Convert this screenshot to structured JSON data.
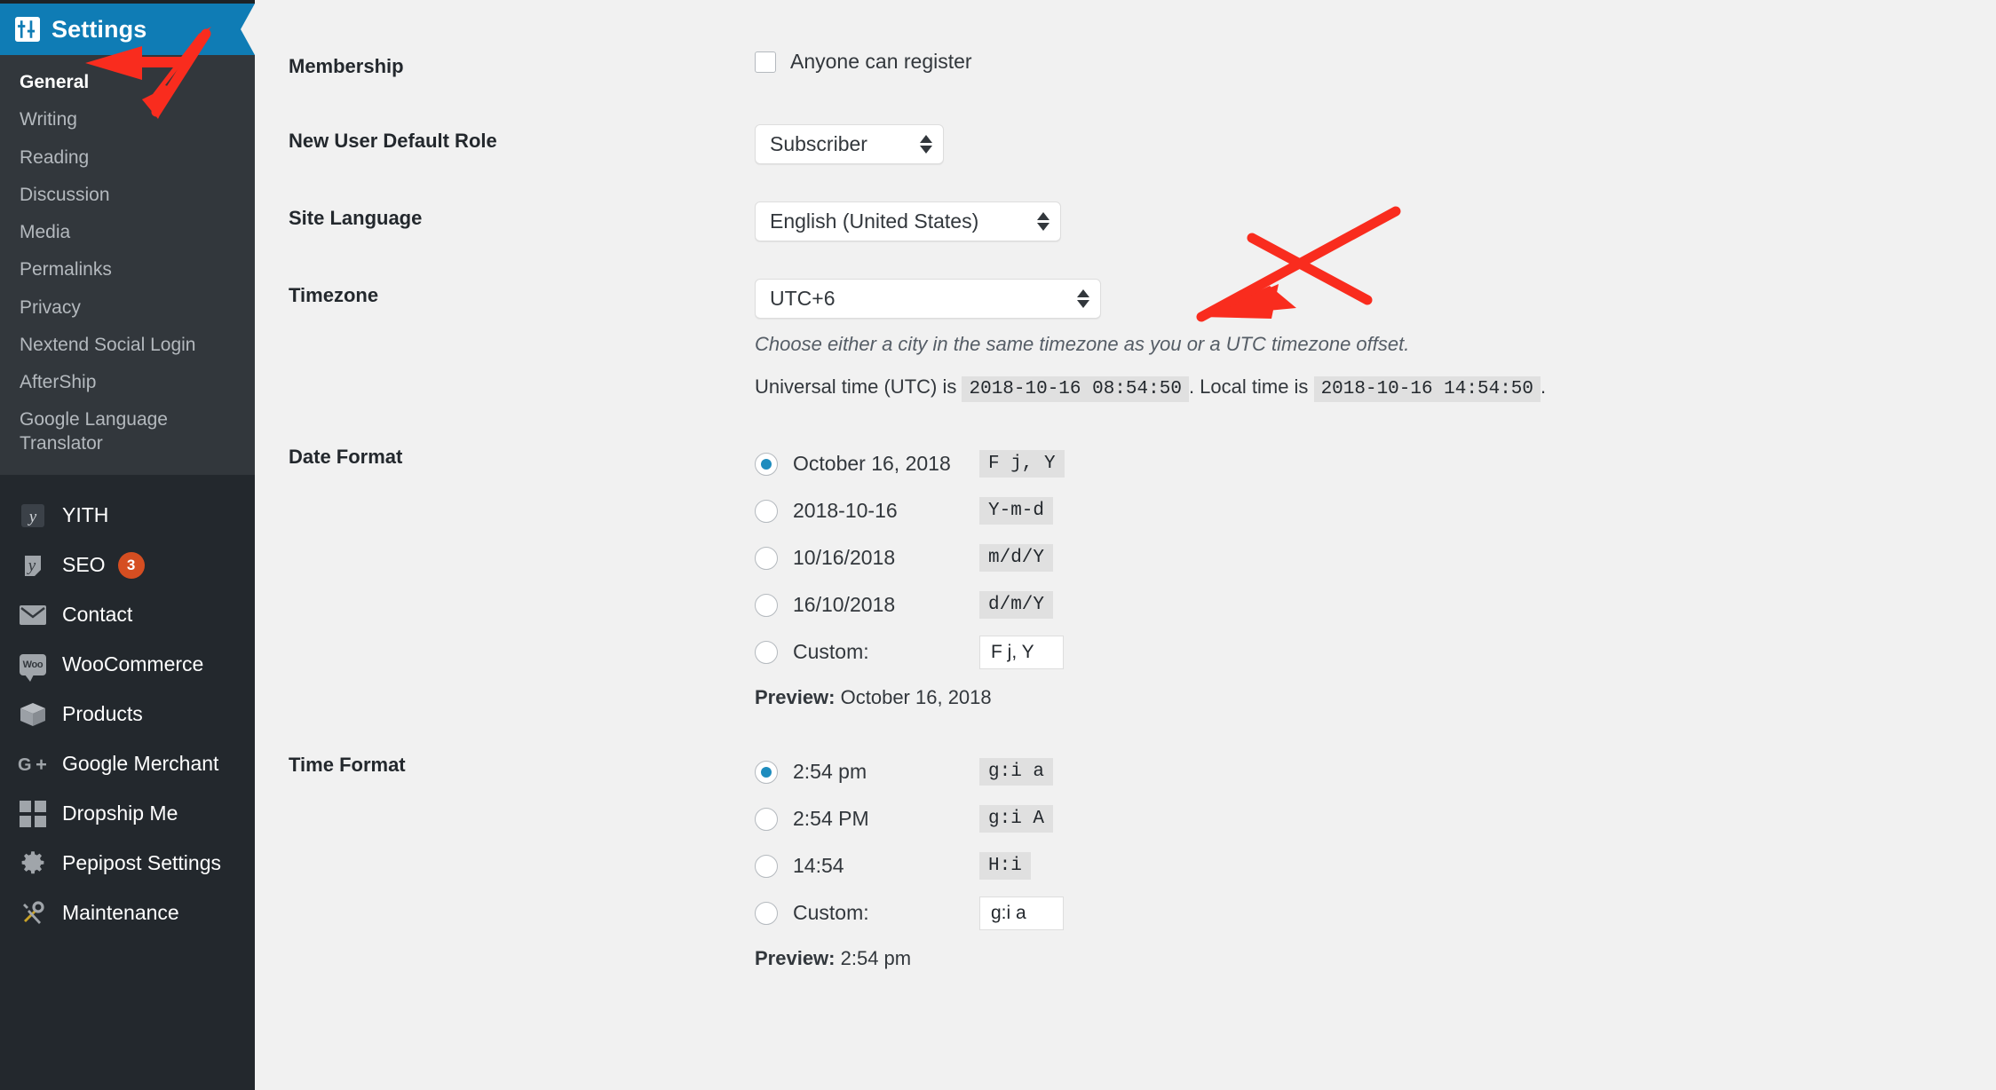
{
  "sidebar": {
    "header": {
      "title": "Settings",
      "icon": "settings-sliders-icon"
    },
    "submenu": [
      {
        "label": "General",
        "current": true
      },
      {
        "label": "Writing",
        "current": false
      },
      {
        "label": "Reading",
        "current": false
      },
      {
        "label": "Discussion",
        "current": false
      },
      {
        "label": "Media",
        "current": false
      },
      {
        "label": "Permalinks",
        "current": false
      },
      {
        "label": "Privacy",
        "current": false
      },
      {
        "label": "Nextend Social Login",
        "current": false
      },
      {
        "label": "AfterShip",
        "current": false
      },
      {
        "label": "Google Language Translator",
        "current": false
      }
    ],
    "menu": [
      {
        "label": "YITH",
        "icon": "yith-icon",
        "badge": null
      },
      {
        "label": "SEO",
        "icon": "yoast-seo-icon",
        "badge": "3"
      },
      {
        "label": "Contact",
        "icon": "envelope-icon",
        "badge": null
      },
      {
        "label": "WooCommerce",
        "icon": "woocommerce-icon",
        "badge": null
      },
      {
        "label": "Products",
        "icon": "box-icon",
        "badge": null
      },
      {
        "label": "Google Merchant",
        "icon": "google-plus-icon",
        "badge": null
      },
      {
        "label": "Dropship Me",
        "icon": "grid-icon",
        "badge": null
      },
      {
        "label": "Pepipost Settings",
        "icon": "gear-icon",
        "badge": null
      },
      {
        "label": "Maintenance",
        "icon": "tools-icon",
        "badge": null
      }
    ]
  },
  "settings": {
    "membership": {
      "label": "Membership",
      "checkbox_label": "Anyone can register",
      "checked": false
    },
    "new_user_role": {
      "label": "New User Default Role",
      "value": "Subscriber"
    },
    "site_language": {
      "label": "Site Language",
      "value": "English (United States)"
    },
    "timezone": {
      "label": "Timezone",
      "value": "UTC+6",
      "hint": "Choose either a city in the same timezone as you or a UTC timezone offset.",
      "utc_prefix": "Universal time (UTC) is",
      "utc_value": "2018-10-16 08:54:50",
      "local_prefix": ". Local time is",
      "local_value": "2018-10-16 14:54:50",
      "suffix": "."
    },
    "date_format": {
      "label": "Date Format",
      "options": [
        {
          "text": "October 16, 2018",
          "code": "F j, Y",
          "selected": true,
          "is_input": false
        },
        {
          "text": "2018-10-16",
          "code": "Y-m-d",
          "selected": false,
          "is_input": false
        },
        {
          "text": "10/16/2018",
          "code": "m/d/Y",
          "selected": false,
          "is_input": false
        },
        {
          "text": "16/10/2018",
          "code": "d/m/Y",
          "selected": false,
          "is_input": false
        },
        {
          "text": "Custom:",
          "code": "F j, Y",
          "selected": false,
          "is_input": true
        }
      ],
      "preview_label": "Preview:",
      "preview_value": "October 16, 2018"
    },
    "time_format": {
      "label": "Time Format",
      "options": [
        {
          "text": "2:54 pm",
          "code": "g:i a",
          "selected": true,
          "is_input": false
        },
        {
          "text": "2:54 PM",
          "code": "g:i A",
          "selected": false,
          "is_input": false
        },
        {
          "text": "14:54",
          "code": "H:i",
          "selected": false,
          "is_input": false
        },
        {
          "text": "Custom:",
          "code": "g:i a",
          "selected": false,
          "is_input": true
        }
      ],
      "preview_label": "Preview:",
      "preview_value": "2:54 pm"
    }
  },
  "colors": {
    "sidebar_bg": "#23282d",
    "submenu_bg": "#32373c",
    "header_blue": "#0f7cb5",
    "accent_radio": "#1e8cbe",
    "badge_orange": "#d54e21",
    "annotation_red": "#f92c1e",
    "page_bg": "#f1f1f1"
  },
  "annotations": [
    {
      "name": "arrow-to-settings-header",
      "color": "#f92c1e"
    },
    {
      "name": "arrow-to-general-item",
      "color": "#f92c1e"
    },
    {
      "name": "arrow-to-timezone-select",
      "color": "#f92c1e"
    }
  ]
}
